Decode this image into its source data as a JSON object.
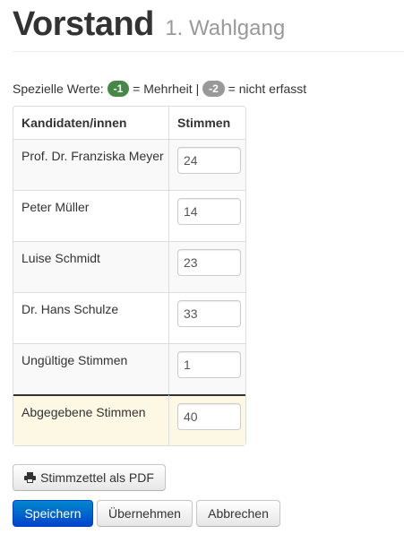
{
  "header": {
    "title": "Vorstand",
    "subtitle": "1. Wahlgang"
  },
  "special_values": {
    "prefix": "Spezielle Werte:",
    "majority_badge": "-1",
    "majority_text": "= Mehrheit |",
    "unrecorded_badge": "-2",
    "unrecorded_text": "= nicht erfasst"
  },
  "table": {
    "headers": [
      "Kandidaten/innen",
      "Stimmen"
    ],
    "rows": [
      {
        "name": "Prof. Dr. Franziska Meyer",
        "votes": "24"
      },
      {
        "name": "Peter Müller",
        "votes": "14"
      },
      {
        "name": "Luise Schmidt",
        "votes": "23"
      },
      {
        "name": "Dr. Hans Schulze",
        "votes": "33"
      },
      {
        "name": "Ungültige Stimmen",
        "votes": "1"
      },
      {
        "name": "Abgegebene Stimmen",
        "votes": "40"
      }
    ]
  },
  "buttons": {
    "pdf": "Stimmzettel als PDF",
    "save": "Speichern",
    "apply": "Übernehmen",
    "cancel": "Abbrechen"
  },
  "colors": {
    "badge_green": "#468847",
    "badge_grey": "#999999",
    "primary": "#0055cc",
    "total_row": "#fcf8e3"
  }
}
